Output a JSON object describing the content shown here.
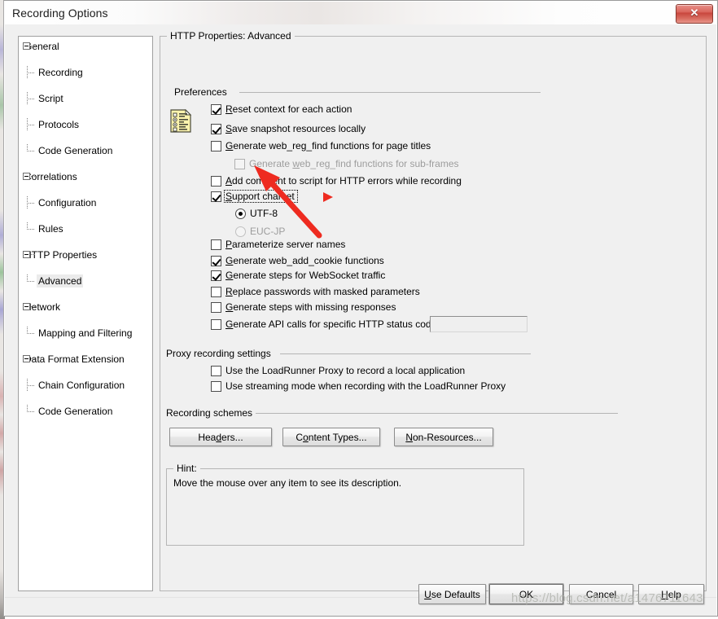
{
  "window": {
    "title": "Recording Options",
    "close_label": "✕"
  },
  "tree": {
    "nodes": [
      {
        "label": "General",
        "level": 0,
        "expanded": true,
        "selected": false
      },
      {
        "label": "Recording",
        "level": 1,
        "expanded": false,
        "selected": false
      },
      {
        "label": "Script",
        "level": 1,
        "expanded": false,
        "selected": false
      },
      {
        "label": "Protocols",
        "level": 1,
        "expanded": false,
        "selected": false
      },
      {
        "label": "Code Generation",
        "level": 1,
        "expanded": false,
        "selected": false
      },
      {
        "label": "Correlations",
        "level": 0,
        "expanded": true,
        "selected": false
      },
      {
        "label": "Configuration",
        "level": 1,
        "expanded": false,
        "selected": false
      },
      {
        "label": "Rules",
        "level": 1,
        "expanded": false,
        "selected": false
      },
      {
        "label": "HTTP Properties",
        "level": 0,
        "expanded": true,
        "selected": false
      },
      {
        "label": "Advanced",
        "level": 1,
        "expanded": false,
        "selected": true
      },
      {
        "label": "Network",
        "level": 0,
        "expanded": true,
        "selected": false
      },
      {
        "label": "Mapping and Filtering",
        "level": 1,
        "expanded": false,
        "selected": false
      },
      {
        "label": "Data Format Extension",
        "level": 0,
        "expanded": true,
        "selected": false
      },
      {
        "label": "Chain Configuration",
        "level": 1,
        "expanded": false,
        "selected": false
      },
      {
        "label": "Code Generation",
        "level": 1,
        "expanded": false,
        "selected": false
      }
    ]
  },
  "main": {
    "group_title": "HTTP Properties: Advanced",
    "preferences": {
      "section_label": "Preferences",
      "icon": "options-document-icon",
      "items": [
        {
          "label": "Reset context for each action",
          "mnemonic": "R",
          "checked": true,
          "disabled": false,
          "indent": 0,
          "focused": false
        },
        {
          "label": "Save snapshot resources locally",
          "mnemonic": "S",
          "checked": true,
          "disabled": false,
          "indent": 0,
          "focused": false
        },
        {
          "label": "Generate web_reg_find functions for page titles",
          "mnemonic": "G",
          "checked": false,
          "disabled": false,
          "indent": 0,
          "focused": false
        },
        {
          "label": "Generate web_reg_find functions for sub-frames",
          "mnemonic": "w",
          "checked": false,
          "disabled": true,
          "indent": 1,
          "focused": false
        },
        {
          "label": "Add comment to script for HTTP errors while recording",
          "mnemonic": "A",
          "checked": false,
          "disabled": false,
          "indent": 0,
          "focused": false
        },
        {
          "label": "Support charset",
          "mnemonic": "S",
          "checked": true,
          "disabled": false,
          "indent": 0,
          "focused": true
        }
      ],
      "charset_options": [
        {
          "label": "UTF-8",
          "mnemonic": "F",
          "selected": true,
          "disabled": false
        },
        {
          "label": "EUC-JP",
          "mnemonic": "C",
          "selected": false,
          "disabled": true
        }
      ],
      "items_lower": [
        {
          "label": "Parameterize server names",
          "mnemonic": "P",
          "checked": false
        },
        {
          "label": "Generate web_add_cookie functions",
          "mnemonic": "G",
          "checked": true
        },
        {
          "label": "Generate steps for WebSocket traffic",
          "mnemonic": "G",
          "checked": true
        },
        {
          "label": "Replace passwords with masked parameters",
          "mnemonic": "R",
          "checked": false
        },
        {
          "label": "Generate steps with missing responses",
          "mnemonic": "G",
          "checked": false
        },
        {
          "label": "Generate API calls for specific HTTP status codes:",
          "mnemonic": "G",
          "checked": false
        }
      ],
      "status_codes_value": "",
      "status_codes_placeholder": ""
    },
    "proxy": {
      "section_label": "Proxy recording settings",
      "items": [
        {
          "label": "Use the LoadRunner Proxy to record a local application",
          "checked": false
        },
        {
          "label": "Use streaming mode when recording with the LoadRunner Proxy",
          "checked": false
        }
      ]
    },
    "schemes": {
      "section_label": "Recording schemes",
      "buttons": [
        {
          "label": "Headers...",
          "mnemonic": "d"
        },
        {
          "label": "Content Types...",
          "mnemonic": "o"
        },
        {
          "label": "Non-Resources...",
          "mnemonic": "N"
        }
      ]
    },
    "hint": {
      "title": "Hint:",
      "text": "Move the mouse over any item to see its description."
    }
  },
  "footer": {
    "buttons": [
      {
        "label": "Use Defaults",
        "mnemonic": "U",
        "default": false
      },
      {
        "label": "OK",
        "mnemonic": "",
        "default": true
      },
      {
        "label": "Cancel",
        "mnemonic": "",
        "default": false
      },
      {
        "label": "Help",
        "mnemonic": "H",
        "default": false
      }
    ]
  },
  "annotation": {
    "arrow_color": "#ee2b20",
    "marker": "red-triangle-marker"
  },
  "watermark": {
    "text": "https://blog.csdn.net/a1476711643"
  }
}
